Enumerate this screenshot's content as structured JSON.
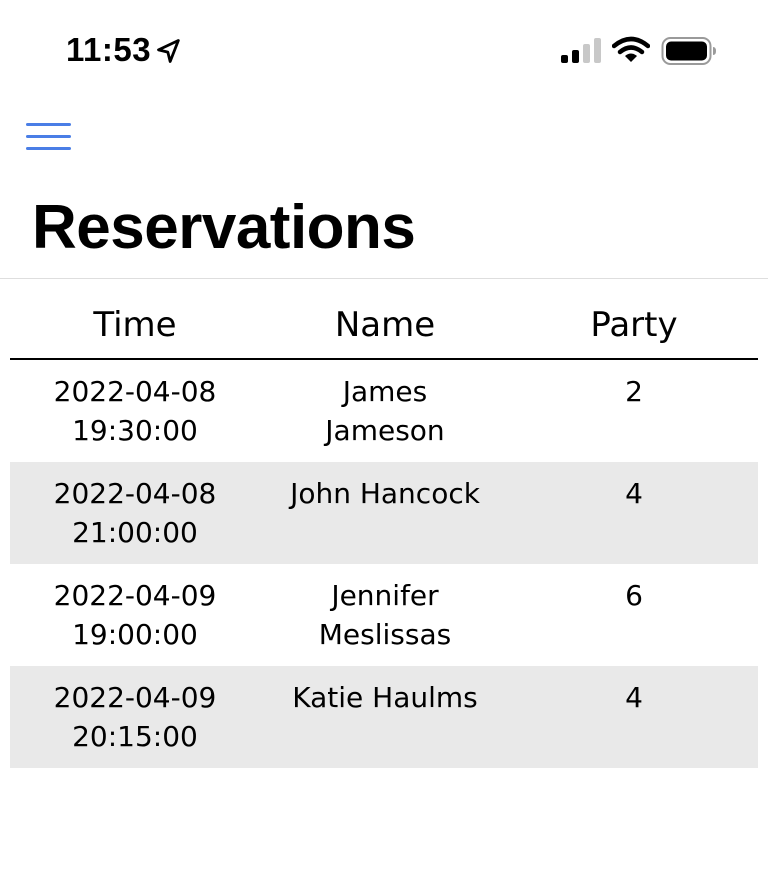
{
  "status_bar": {
    "time": "11:53",
    "icons": [
      "location-arrow-icon",
      "cellular-signal-icon",
      "wifi-icon",
      "battery-icon"
    ]
  },
  "nav": {
    "menu_icon": "hamburger-menu-icon",
    "accent_color": "#4a7ee6"
  },
  "page": {
    "title": "Reservations"
  },
  "table": {
    "headers": {
      "time": "Time",
      "name": "Name",
      "party": "Party"
    },
    "rows": [
      {
        "date": "2022-04-08",
        "time": "19:30:00",
        "name_first": "James",
        "name_last": "Jameson",
        "party": "2"
      },
      {
        "date": "2022-04-08",
        "time": "21:00:00",
        "name_first": "John Hancock",
        "name_last": "",
        "party": "4"
      },
      {
        "date": "2022-04-09",
        "time": "19:00:00",
        "name_first": "Jennifer",
        "name_last": "Meslissas",
        "party": "6"
      },
      {
        "date": "2022-04-09",
        "time": "20:15:00",
        "name_first": "Katie Haulms",
        "name_last": "",
        "party": "4"
      }
    ],
    "stripe_color": "#e9e9e9"
  }
}
